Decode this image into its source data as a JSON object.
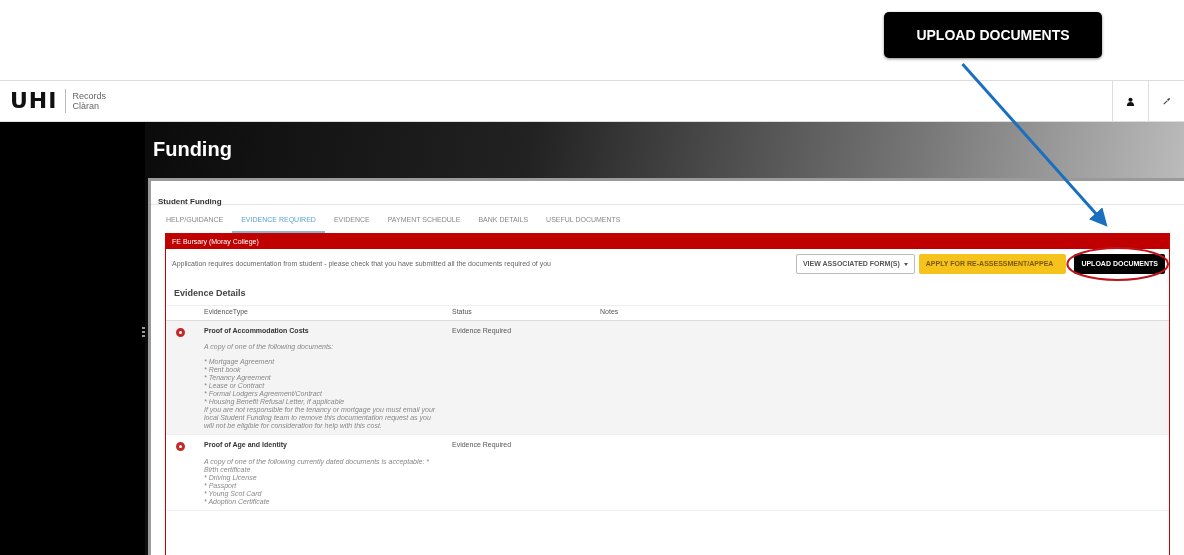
{
  "annotation": {
    "callout": "UPLOAD DOCUMENTS"
  },
  "header": {
    "logo": "UHI",
    "app_name": [
      "Records",
      "Clàran"
    ]
  },
  "page_title": "Funding",
  "card": {
    "title": "Student Funding",
    "tabs": [
      {
        "label": "HELP/GUIDANCE",
        "selected": false
      },
      {
        "label": "EVIDENCE REQUIRED",
        "selected": true
      },
      {
        "label": "EVIDENCE",
        "selected": false
      },
      {
        "label": "PAYMENT SCHEDULE",
        "selected": false
      },
      {
        "label": "BANK DETAILS",
        "selected": false
      },
      {
        "label": "USEFUL DOCUMENTS",
        "selected": false
      }
    ],
    "panel": {
      "title": "FE Bursary (Moray College)",
      "message": "Application requires documentation from student - please check that you have submitted all the documents required of you",
      "buttons": [
        {
          "label": "VIEW ASSOCIATED FORM(S)",
          "kind": "dropdown",
          "highlighted": false
        },
        {
          "label": "APPLY FOR RE-ASSESSMENT/APPEA",
          "kind": "warning",
          "highlighted": false
        },
        {
          "label": "UPLOAD DOCUMENTS",
          "kind": "dark",
          "highlighted": true
        }
      ],
      "section_title": "Evidence Details",
      "table": {
        "columns": [
          "EvidenceType",
          "Status",
          "Notes"
        ],
        "rows": [
          {
            "title": "Proof of Accommodation Costs",
            "status": "Evidence Required",
            "description": [
              [
                "A copy of one of the following documents:"
              ],
              [
                "* Mortgage Agreement",
                "* Rent book",
                "* Tenancy Agreement",
                "* Lease or Contract",
                "* Formal Lodgers Agreement/Contract",
                "* Housing Benefit Refusal Letter, if applicable",
                "If you are not responsible for the tenancy or mortgage you must email your",
                "local Student Funding team to remove this documentation request as you",
                "will not be eligible for consideration for help with this cost."
              ]
            ]
          },
          {
            "title": "Proof of Age and Identity",
            "status": "Evidence Required",
            "description": [
              [
                "A copy of one of the following currently dated documents is acceptable: *",
                "Birth certificate",
                "* Driving License",
                "* Passport",
                "* Young Scot Card",
                "* Adoption Certificate"
              ]
            ]
          }
        ]
      }
    }
  }
}
